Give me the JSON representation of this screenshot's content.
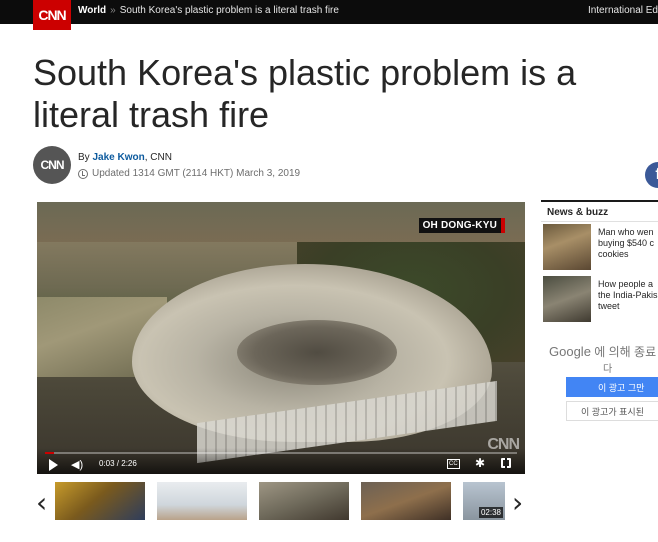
{
  "nav": {
    "logo": "CNN",
    "section": "World",
    "separator": "»",
    "breadcrumb_title": "South Korea's plastic problem is a literal trash fire",
    "edition": "International Ed"
  },
  "article": {
    "headline": "South Korea's plastic problem is a literal trash fire",
    "byline_prefix": "By",
    "author": "Jake Kwon",
    "outlet": ", CNN",
    "avatar_label": "CNN",
    "updated": "Updated 1314 GMT (2114 HKT) March 3, 2019"
  },
  "video": {
    "credit_tag": "OH DONG-KYU",
    "watermark": "CNN",
    "time": "0:03 / 2:26",
    "progress": 0.02,
    "cc_label": "CC"
  },
  "sidebar": {
    "heading": "News & buzz",
    "items": [
      {
        "text_lines": [
          "Man who wen",
          "buying $540 c",
          "cookies"
        ]
      },
      {
        "text_lines": [
          "How people a",
          "the India-Pakis",
          "tweet"
        ]
      }
    ]
  },
  "ad": {
    "brand": "Google",
    "line1": "에 의해 종료",
    "line2": "다",
    "stop_button": "이 광고 그만",
    "why_button": "이 광고가 표시된"
  },
  "carousel": {
    "prev_icon": "‹",
    "next_icon": "›",
    "last_duration": "02:38"
  },
  "social": {
    "facebook_label": "f"
  },
  "colors": {
    "brand_red": "#cc0000",
    "link_blue": "#0c5a9e",
    "google_blue": "#4285f4",
    "facebook_blue": "#3b5998"
  }
}
